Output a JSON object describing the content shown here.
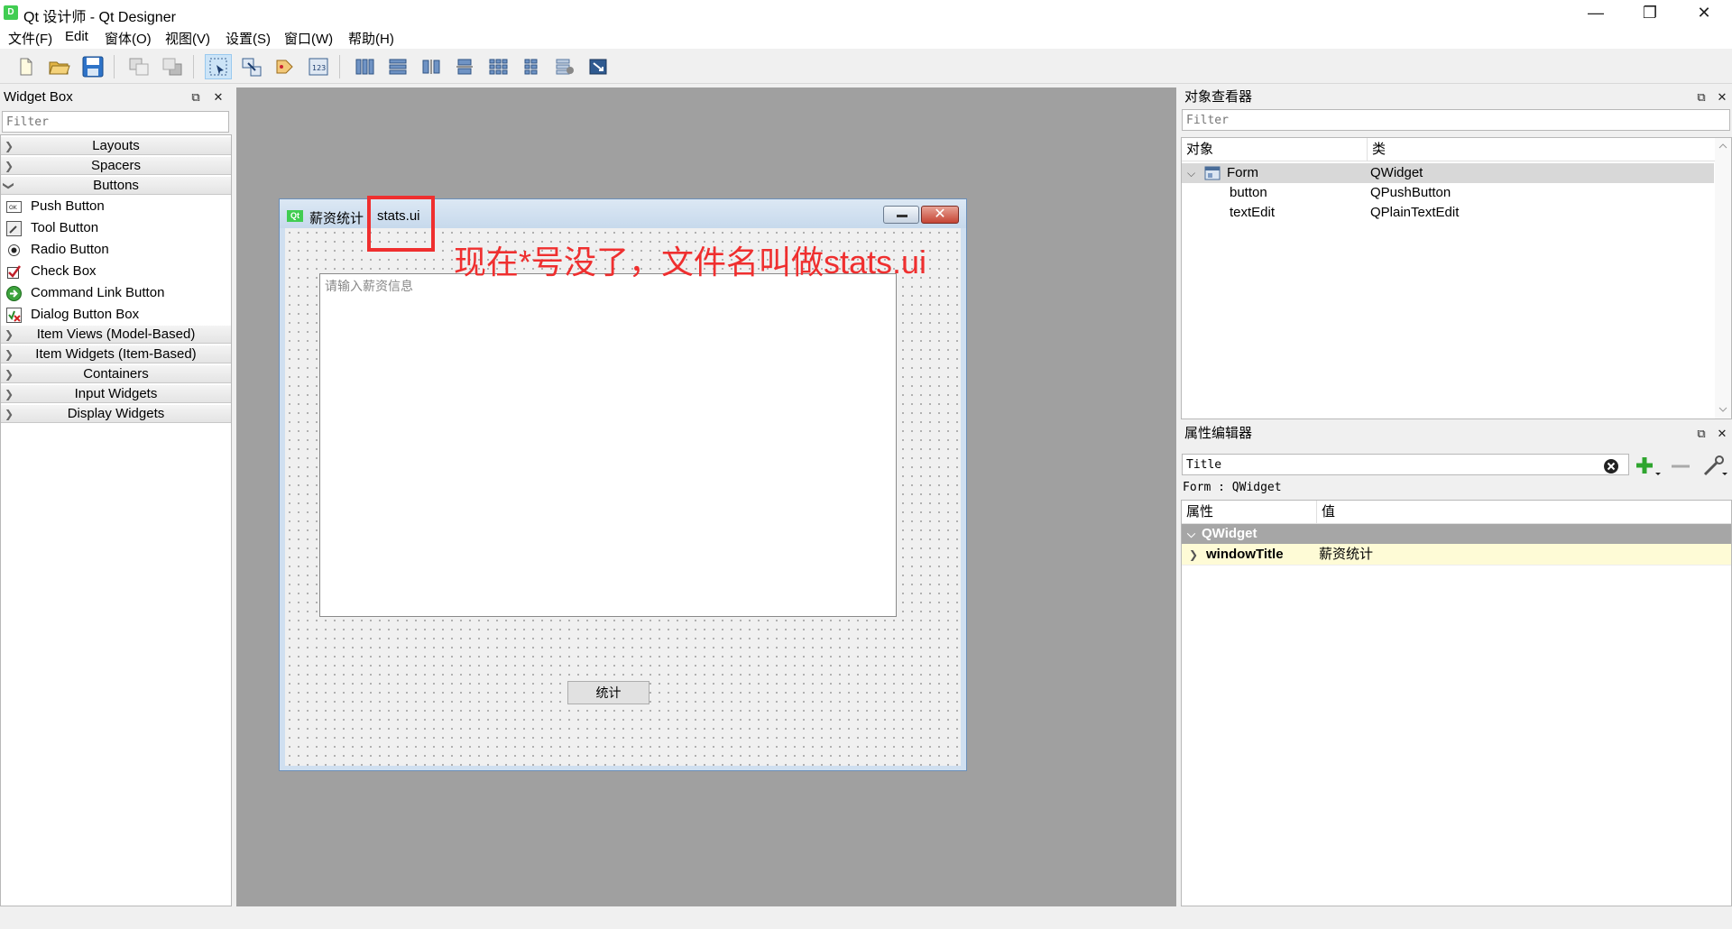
{
  "window": {
    "title": "Qt 设计师 - Qt Designer",
    "logo_text": "D",
    "minimize": "—",
    "maximize": "❐",
    "close": "✕"
  },
  "menubar": {
    "items": [
      "文件(F)",
      "Edit",
      "窗体(O)",
      "视图(V)",
      "设置(S)",
      "窗口(W)",
      "帮助(H)"
    ]
  },
  "toolbar": {
    "icons": [
      "new-file-icon",
      "open-folder-icon",
      "save-icon",
      "send-to-back-icon",
      "bring-to-front-icon",
      "edit-widgets-icon",
      "edit-signals-slots-icon",
      "edit-buddies-icon",
      "edit-tab-order-icon",
      "layout-horizontal-icon",
      "layout-vertical-icon",
      "layout-horizontal-splitter-icon",
      "layout-vertical-splitter-icon",
      "layout-grid-icon",
      "layout-form-icon",
      "break-layout-icon",
      "adjust-size-icon"
    ]
  },
  "widget_box": {
    "title": "Widget Box",
    "filter_placeholder": "Filter",
    "categories": [
      {
        "label": "Layouts",
        "expanded": false
      },
      {
        "label": "Spacers",
        "expanded": false
      },
      {
        "label": "Buttons",
        "expanded": true
      }
    ],
    "button_items": [
      "Push Button",
      "Tool Button",
      "Radio Button",
      "Check Box",
      "Command Link Button",
      "Dialog Button Box"
    ],
    "more_categories": [
      "Item Views (Model-Based)",
      "Item Widgets (Item-Based)",
      "Containers",
      "Input Widgets",
      "Display Widgets"
    ]
  },
  "form": {
    "logo_text": "Qt",
    "title": "薪资统计",
    "filename": "stats.ui",
    "close_glyph": "✕",
    "text_edit_placeholder": "请输入薪资信息",
    "button_label": "统计"
  },
  "annotation": {
    "text": "现在*号没了，文件名叫做stats.ui",
    "color": "#ef2f2f"
  },
  "object_inspector": {
    "title": "对象查看器",
    "filter_placeholder": "Filter",
    "columns": [
      "对象",
      "类"
    ],
    "rows": [
      {
        "object": "Form",
        "class": "QWidget",
        "selected": true
      },
      {
        "object": "button",
        "class": "QPushButton",
        "selected": false
      },
      {
        "object": "textEdit",
        "class": "QPlainTextEdit",
        "selected": false
      }
    ]
  },
  "property_editor": {
    "title": "属性编辑器",
    "filter_value": "Title",
    "context": "Form : QWidget",
    "columns": [
      "属性",
      "值"
    ],
    "group": "QWidget",
    "property": {
      "name": "windowTitle",
      "value": "薪资统计"
    }
  }
}
